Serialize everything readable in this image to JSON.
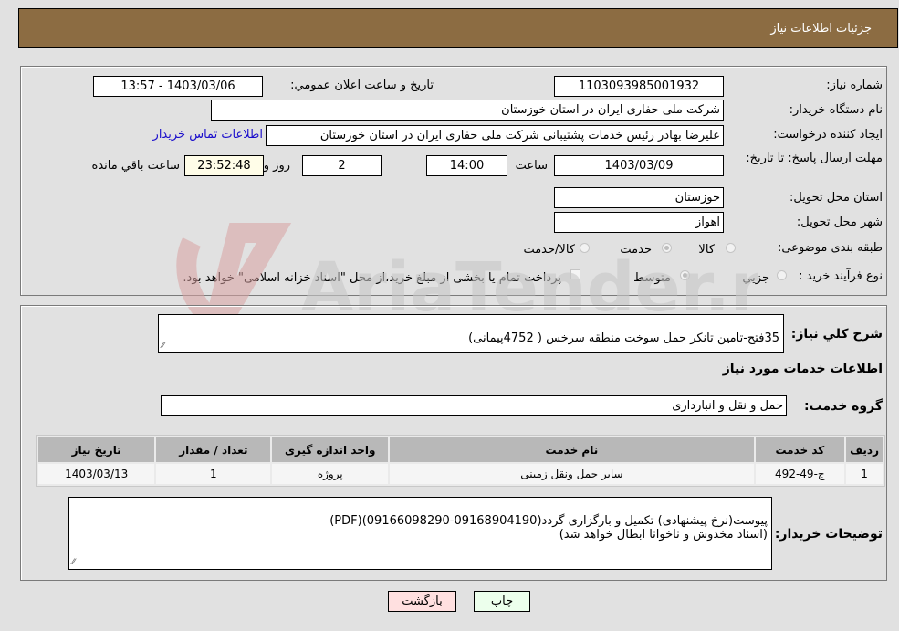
{
  "header": {
    "title": "جزئیات اطلاعات نیاز"
  },
  "details": {
    "need_number_label": "شماره نیاز:",
    "need_number": "1103093985001932",
    "announce_label": "تاریخ و ساعت اعلان عمومي:",
    "announce_value": "1403/03/06 - 13:57",
    "buyer_org_label": "نام دستگاه خريدار:",
    "buyer_org": "شرکت ملی حفاری ایران در استان خوزستان",
    "creator_label": "ایجاد کننده درخواست:",
    "creator": "علیرضا بهادر رئیس خدمات پشتیبانی شرکت ملی حفاری ایران در استان خوزستان",
    "contact_link": "اطلاعات تماس خریدار",
    "deadline_label": "مهلت ارسال پاسخ: تا تاریخ:",
    "deadline_date": "1403/03/09",
    "time_label": "ساعت",
    "deadline_time": "14:00",
    "days_value": "2",
    "days_label": "روز و",
    "remaining_time": "23:52:48",
    "remaining_label": "ساعت باقي مانده",
    "province_label": "استان محل تحویل:",
    "province": "خوزستان",
    "city_label": "شهر محل تحویل:",
    "city": "اهواز",
    "category_label": "طبقه بندی موضوعی:",
    "category_options": [
      {
        "label": "کالا",
        "selected": false
      },
      {
        "label": "خدمت",
        "selected": true
      },
      {
        "label": "کالا/خدمت",
        "selected": false
      }
    ],
    "process_label": "نوع فرآیند خرید :",
    "process_options": [
      {
        "label": "جزيي",
        "selected": false
      },
      {
        "label": "متوسط",
        "selected": true
      }
    ],
    "treasury_checkbox_label": "پرداخت تمام یا بخشی از مبلغ خرید،از محل \"اسناد خزانه اسلامی\" خواهد بود.",
    "treasury_checked": false
  },
  "summary": {
    "label": "شرح کلي نياز:",
    "value": "35فتح-تامین تانکر حمل سوخت منطقه سرخس ( 4752پیمانی)"
  },
  "services": {
    "section_title": "اطلاعات خدمات مورد نياز",
    "group_label": "گروه خدمت:",
    "group_value": "حمل و نقل و انبارداری",
    "columns": [
      "رديف",
      "کد خدمت",
      "نام خدمت",
      "واحد اندازه گیری",
      "تعداد / مقدار",
      "تاریخ نیاز"
    ],
    "rows": [
      [
        "1",
        "ج-49-492",
        "سایر حمل ونقل زمینی",
        "پروژه",
        "1",
        "1403/03/13"
      ]
    ]
  },
  "buyer_notes": {
    "label": "توضیحات خریدار:",
    "value": "پیوست(نرخ پیشنهادی) تکمیل و بارگزاری گردد(09168904190-09166098290)(PDF)\n(اسناد مخدوش و ناخوانا ابطال خواهد شد)"
  },
  "buttons": {
    "print": "چاپ",
    "back": "بازگشت"
  },
  "watermark": {
    "text": "AriaTender.neT"
  }
}
